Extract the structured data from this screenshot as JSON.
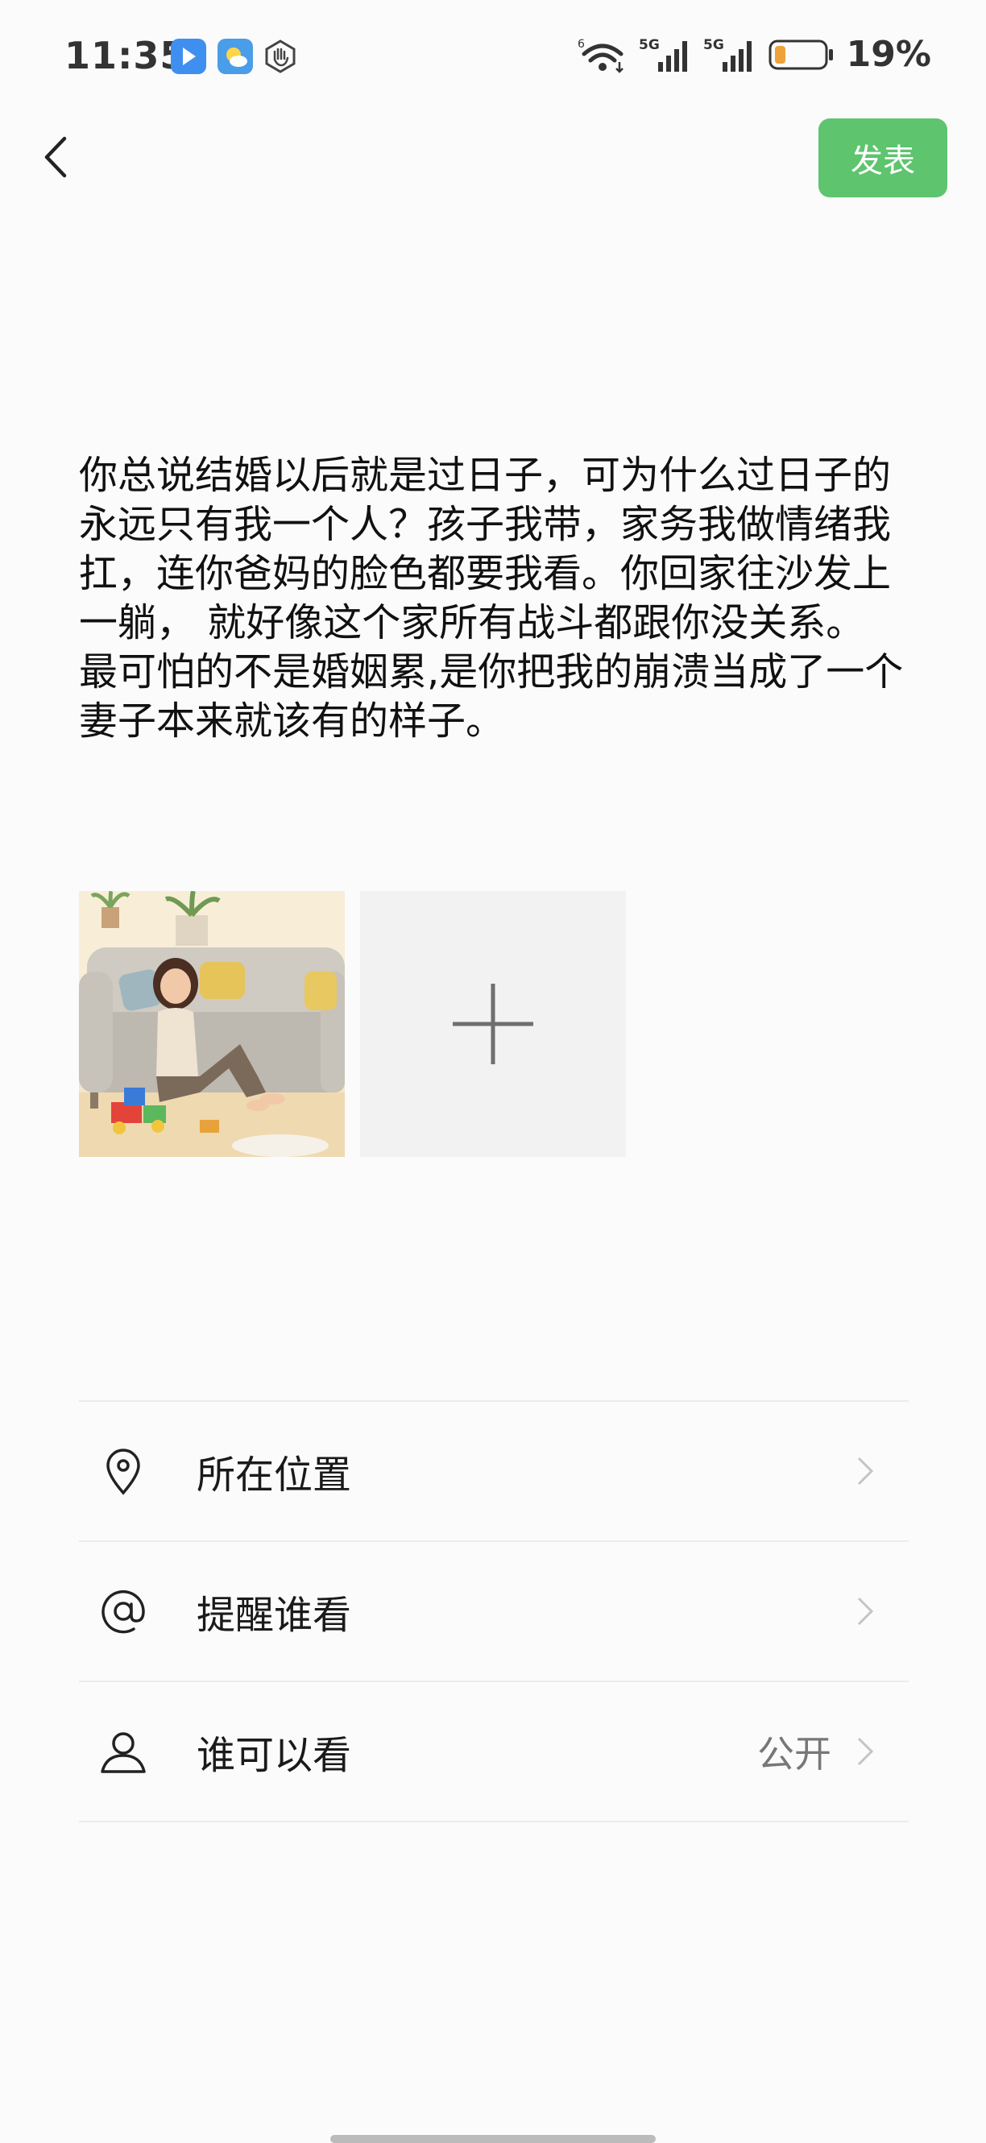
{
  "status_bar": {
    "time": "11:35",
    "net1": "5G",
    "net2": "5G",
    "wifi_tag": "6",
    "battery": "19%",
    "battery_color": "#f0a23a"
  },
  "nav": {
    "back_icon": "chevron-left-icon",
    "publish_label": "发表",
    "publish_color": "#5ec46e"
  },
  "post": {
    "text": "你总说结婚以后就是过日子，可为什么过日子的永远只有我一个人？孩子我带，家务我做情绪我扛，连你爸妈的脸色都要我看。你回家往沙发上一躺， 就好像这个家所有战斗都跟你没关系。 最可怕的不是婚姻累,是你把我的崩溃当成了一个妻子本来就该有的样子。"
  },
  "media": {
    "add_icon": "plus-icon"
  },
  "options": [
    {
      "icon": "location-pin-icon",
      "label": "所在位置",
      "value": ""
    },
    {
      "icon": "at-icon",
      "label": "提醒谁看",
      "value": ""
    },
    {
      "icon": "person-icon",
      "label": "谁可以看",
      "value": "公开"
    }
  ]
}
